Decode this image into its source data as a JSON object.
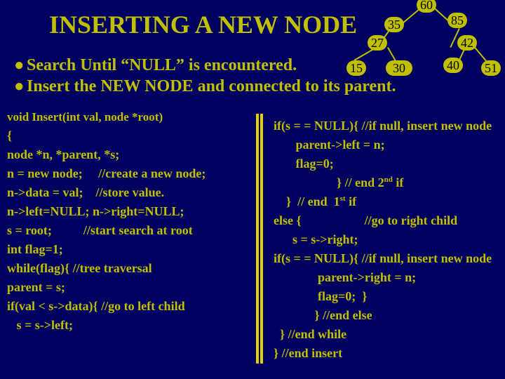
{
  "title": "INSERTING A NEW NODE",
  "bullet1": "Search Until “NULL” is encountered.",
  "bullet2": "Insert the NEW NODE and connected to its parent.",
  "tree": {
    "n60": "60",
    "n35": "35",
    "n85": "85",
    "n27": "27",
    "n42": "42",
    "n15": "15",
    "n30": "30",
    "n40": "40",
    "n51": "51"
  },
  "codeL": {
    "l0": "void Insert(int val, node *root)",
    "l1": "{",
    "l2": "node *n, *parent, *s;",
    "l3": "n = new node;     //create a new node;",
    "l4": "n->data = val;    //store value.",
    "l5": "n->left=NULL; n->right=NULL;",
    "l6": "s = root;          //start search at root",
    "l7": "int flag=1;",
    "l8": "while(flag){ //tree traversal",
    "l9": "parent = s;",
    "l10": "if(val < s->data){ //go to left child",
    "l11": "   s = s->left;"
  },
  "codeR": {
    "r0a": "if(s = = NULL){ //if null, insert new node",
    "r1": "       parent->left = n;",
    "r2": "       flag=0;",
    "r3a": "                    } // end 2",
    "r3b": " if",
    "r4a": "    }  // end  1",
    "r4b": " if",
    "r5": "else {                    //go to right child",
    "r6": "      s = s->right;",
    "r7": "if(s = = NULL){ //if null, insert new node",
    "r8": "              parent->right = n;",
    "r9": "              flag=0;  }",
    "r10": "             } //end else",
    "r11": "  } //end while",
    "r12": "} //end insert"
  },
  "sup": {
    "nd": "nd",
    "st": "st"
  }
}
